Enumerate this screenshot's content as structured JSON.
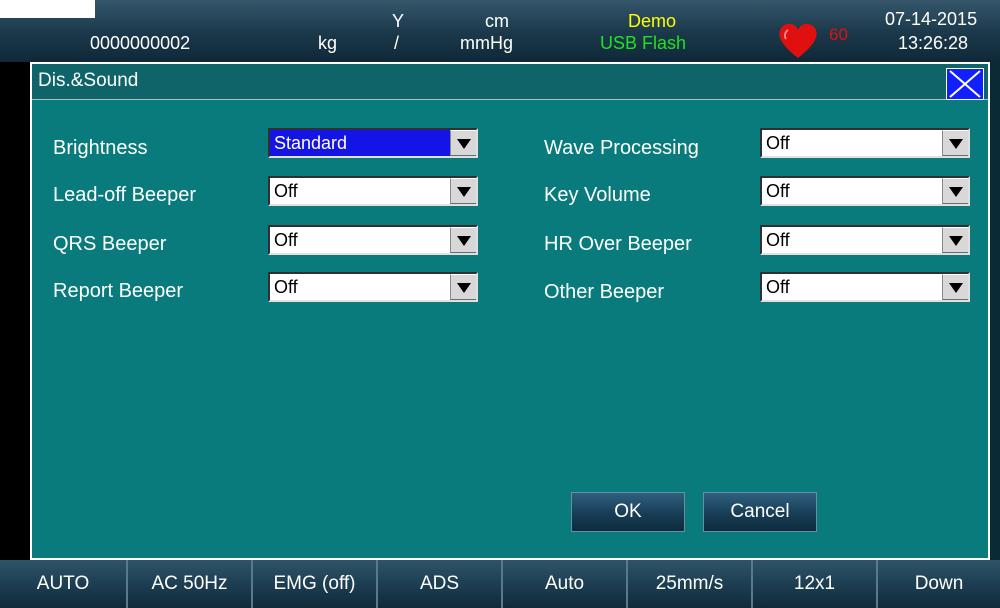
{
  "status_bar": {
    "patient_id": "0000000002",
    "unit_kg": "kg",
    "y": "Y",
    "slash": "/",
    "unit_cm": "cm",
    "unit_mmhg": "mmHg",
    "mode": "Demo",
    "storage": "USB Flash",
    "heart_rate": "60",
    "date": "07-14-2015",
    "time": "13:26:28",
    "colors": {
      "mode": "#ffff00",
      "storage": "#22e022",
      "heart": "#e01010",
      "heart_rate": "#e01010"
    }
  },
  "dialog": {
    "title": "Dis.&Sound",
    "close_icon": "close-x-icon",
    "left_settings": [
      {
        "label": "Brightness",
        "value": "Standard",
        "selected": true
      },
      {
        "label": "Lead-off Beeper",
        "value": "Off"
      },
      {
        "label": "QRS Beeper",
        "value": "Off"
      },
      {
        "label": "Report Beeper",
        "value": "Off"
      }
    ],
    "right_settings": [
      {
        "label": "Wave Processing",
        "value": "Off"
      },
      {
        "label": "Key Volume",
        "value": "Off"
      },
      {
        "label": "HR Over Beeper",
        "value": "Off"
      },
      {
        "label": "Other Beeper",
        "value": "Off"
      }
    ],
    "ok_label": "OK",
    "cancel_label": "Cancel"
  },
  "bottom_bar": {
    "items": [
      "AUTO",
      "AC 50Hz",
      "EMG (off)",
      "ADS",
      "Auto",
      "25mm/s",
      "12x1",
      "Down"
    ]
  }
}
